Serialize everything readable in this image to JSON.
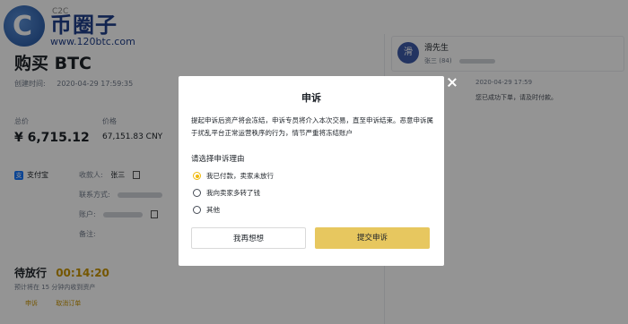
{
  "logo": {
    "letter": "C",
    "title": "币圈子",
    "url": "www.120btc.com"
  },
  "header": {
    "top_text": "C2C"
  },
  "order": {
    "title": "购买 BTC",
    "created_label": "创建时间:",
    "created_value": "2020-04-29 17:59:35",
    "total_label": "总价",
    "total_value": "¥ 6,715.12",
    "price_label": "价格",
    "price_value": "67,151.83 CNY",
    "pay_method": "支付宝",
    "pay_icon": "支",
    "payee_label": "收款人:",
    "payee_value": "张三",
    "contact_label": "联系方式:",
    "account_label": "账户:",
    "note_label": "备注:",
    "status_label": "待放行",
    "timer": "00:14:20",
    "hint": "预计将在 15 分钟内收到资产",
    "actions": [
      "申诉",
      "取消订单"
    ]
  },
  "chat": {
    "avatar": "滑",
    "name": "滑先生",
    "sub": "张三 (84)",
    "time": "2020-04-29 17:59",
    "message": "您已成功下单，请及时付款。"
  },
  "modal": {
    "title": "申诉",
    "description": "提起申诉后资产将会冻结，申诉专员将介入本次交易，直至申诉结束。恶意申诉属于扰乱平台正常运营秩序的行为，情节严重将冻结账户",
    "reason_label": "请选择申诉理由",
    "options": [
      "我已付款，卖家未放行",
      "我向卖家多转了钱",
      "其他"
    ],
    "selected_index": 0,
    "cancel_label": "我再想想",
    "submit_label": "提交申诉"
  },
  "colors": {
    "accent": "#f0b90b",
    "submit": "#e7c75f",
    "timer": "#c99400",
    "overlay": "rgba(0,0,0,0.42)"
  }
}
